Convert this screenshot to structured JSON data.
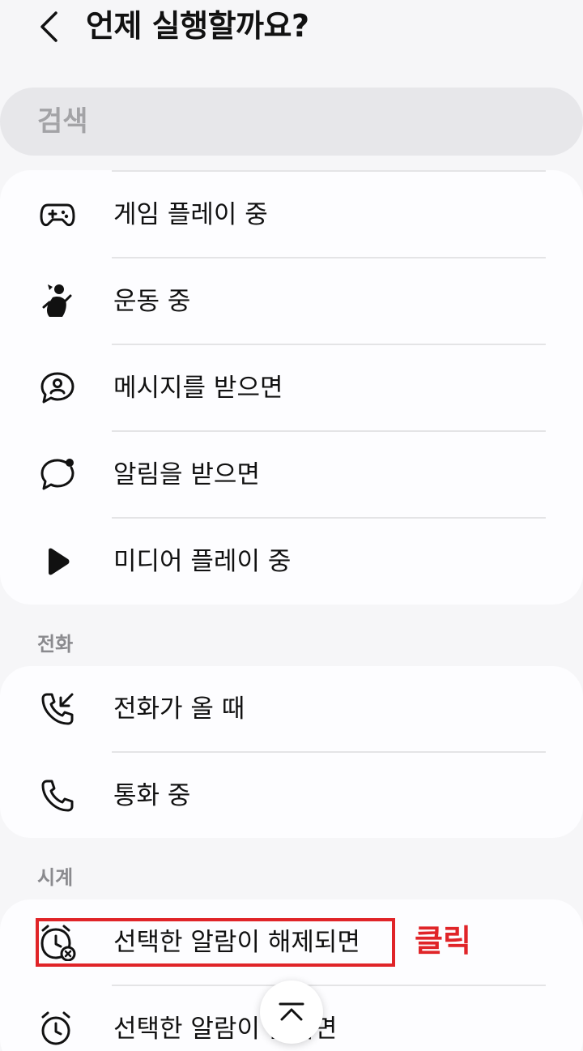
{
  "header": {
    "title": "언제 실행할까요?",
    "back_icon": "chevron-left-icon"
  },
  "search": {
    "placeholder": "검색"
  },
  "general": {
    "items": [
      {
        "label": "게임 플레이 중",
        "icon": "gamepad-icon"
      },
      {
        "label": "운동 중",
        "icon": "running-person-icon"
      },
      {
        "label": "메시지를 받으면",
        "icon": "message-person-icon"
      },
      {
        "label": "알림을 받으면",
        "icon": "notification-bubble-icon"
      },
      {
        "label": "미디어 플레이 중",
        "icon": "play-icon"
      }
    ]
  },
  "phone": {
    "title": "전화",
    "items": [
      {
        "label": "전화가 올 때",
        "icon": "incoming-call-icon"
      },
      {
        "label": "통화 중",
        "icon": "phone-icon"
      }
    ]
  },
  "clock": {
    "title": "시계",
    "items": [
      {
        "label": "선택한 알람이 해제되면",
        "icon": "alarm-dismiss-icon"
      },
      {
        "label": "선택한 알람이 울리면",
        "icon": "alarm-clock-icon"
      }
    ]
  },
  "annotation": {
    "text": "클릭",
    "color": "#e02428"
  },
  "scroll_top": {
    "icon": "scroll-to-top-icon"
  }
}
